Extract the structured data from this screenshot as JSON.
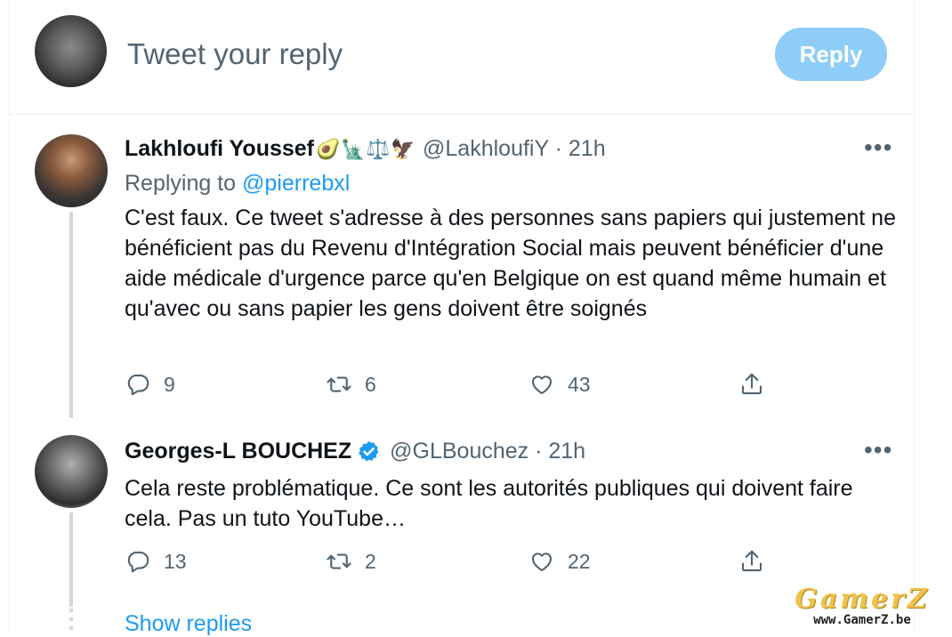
{
  "compose": {
    "placeholder": "Tweet your reply",
    "reply_label": "Reply"
  },
  "tweets": [
    {
      "name": "Lakhloufi Youssef",
      "emojis": [
        "🥑",
        "🗽",
        "⚖️",
        "🦅"
      ],
      "handle_time": "@LakhloufiY · 21h",
      "replying_prefix": "Replying to",
      "replying_mention": "@pierrebxl",
      "text": "C'est faux. Ce tweet s'adresse à des personnes sans papiers qui justement ne bénéficient pas du Revenu d'Intégration Social mais peuvent bénéficier d'une aide médicale d'urgence parce qu'en Belgique on est quand même humain et qu'avec ou sans papier les gens doivent être soignés",
      "replies": "9",
      "retweets": "6",
      "likes": "43",
      "more": "•••"
    },
    {
      "name": "Georges-L BOUCHEZ",
      "handle_time": "@GLBouchez · 21h",
      "text": "Cela reste problématique. Ce sont les autorités publiques qui doivent faire cela. Pas un tuto YouTube…",
      "replies": "13",
      "retweets": "2",
      "likes": "22",
      "more": "•••"
    }
  ],
  "show_replies": "Show replies",
  "watermark": {
    "logo": "GamerZ",
    "url": "www.GamerZ.be"
  },
  "colors": {
    "accent": "#1d9bf0",
    "reply_button_disabled": "#8ecdf8",
    "secondary_text": "#536471",
    "thread_line": "#cfd9de"
  }
}
